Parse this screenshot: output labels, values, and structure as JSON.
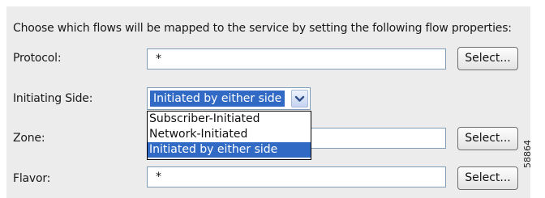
{
  "instructions": "Choose which flows will be mapped to the service by setting the following flow properties:",
  "protocol": {
    "label": "Protocol:",
    "value": "*",
    "button_label": "Select..."
  },
  "initiating_side": {
    "label": "Initiating Side:",
    "selected": "Initiated by either side",
    "options": [
      "Subscriber-Initiated",
      "Network-Initiated",
      "Initiated by either side"
    ],
    "selected_index": 2
  },
  "zone": {
    "label": "Zone:",
    "value": "",
    "button_label": "Select..."
  },
  "flavor": {
    "label": "Flavor:",
    "value": "*",
    "button_label": "Select..."
  },
  "figure_id": "58864",
  "colors": {
    "panel_bg": "#ececec",
    "selection": "#316ac5",
    "field_border": "#7f9db9"
  }
}
